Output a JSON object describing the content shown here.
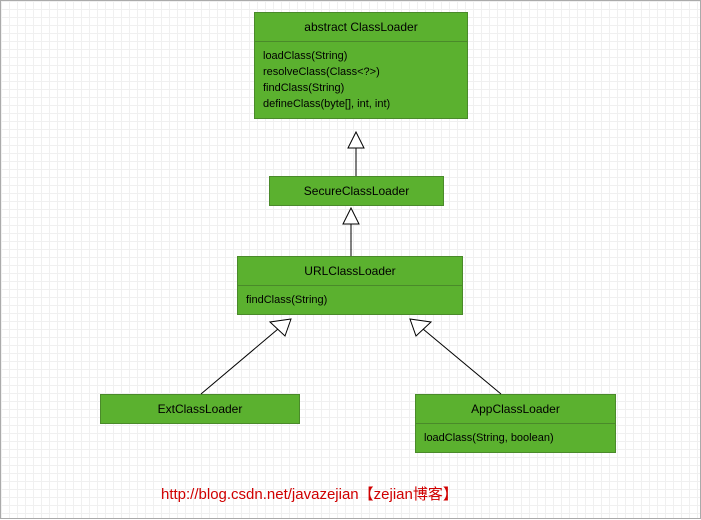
{
  "classes": {
    "classloader": {
      "title": "abstract ClassLoader",
      "methods": [
        "loadClass(String)",
        "resolveClass(Class<?>)",
        "findClass(String)",
        "defineClass(byte[], int, int)"
      ]
    },
    "secure": {
      "title": "SecureClassLoader"
    },
    "url": {
      "title": "URLClassLoader",
      "methods": [
        "findClass(String)"
      ]
    },
    "ext": {
      "title": "ExtClassLoader"
    },
    "app": {
      "title": "AppClassLoader",
      "methods": [
        "loadClass(String, boolean)"
      ]
    }
  },
  "footer": {
    "url": "http://blog.csdn.net/javazejian",
    "label": "【zejian博客】"
  }
}
